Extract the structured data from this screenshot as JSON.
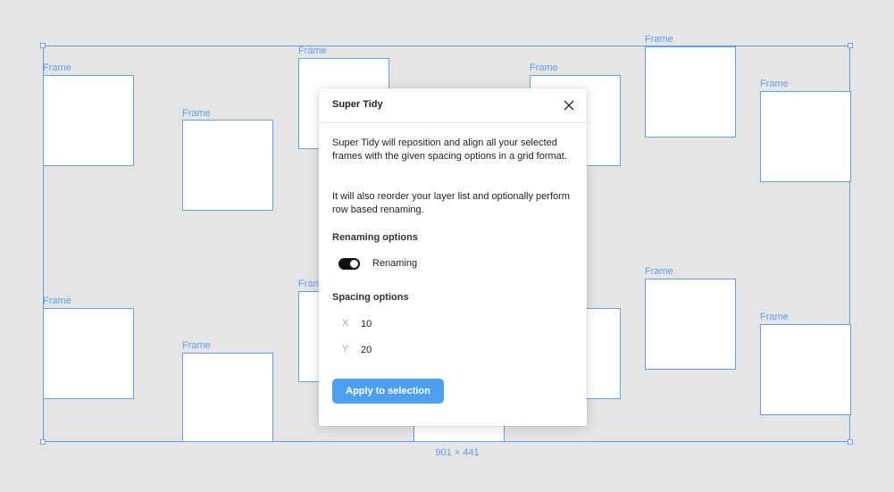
{
  "canvas": {
    "selection_dimensions": "901 × 441",
    "frame_label": "Frame"
  },
  "dialog": {
    "title": "Super Tidy",
    "close_icon": "close-icon",
    "description_1": "Super Tidy will reposition and align all your selected frames with the given spacing options in a grid format.",
    "description_2": "It will also reorder your layer list and optionally perform row based renaming.",
    "renaming": {
      "section_title": "Renaming options",
      "toggle_label": "Renaming",
      "enabled": true
    },
    "spacing": {
      "section_title": "Spacing options",
      "x_label": "X",
      "x_value": "10",
      "y_label": "Y",
      "y_value": "20"
    },
    "apply_label": "Apply to selection"
  },
  "colors": {
    "selection_blue": "#5fa0ec",
    "button_blue": "#4d9ff0",
    "canvas_bg": "#e5e5e5"
  }
}
